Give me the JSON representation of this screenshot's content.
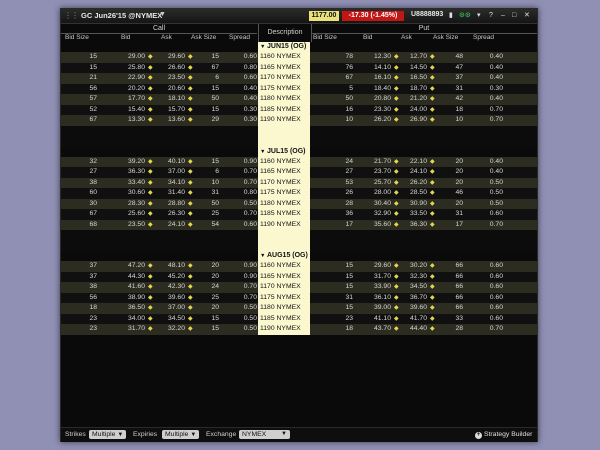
{
  "title_bar": {
    "title": "GC Jun26'15 @NYMEX",
    "price": "1177.00",
    "change": "-17.30 (-1.45%)",
    "account": "U8888893",
    "colors": {
      "price_bg": "#e9e27a",
      "change_bg": "#c41515"
    }
  },
  "headers": {
    "call": "Call",
    "put": "Put",
    "description": "Description",
    "call_columns": [
      "Bid Size",
      "Bid",
      "Ask",
      "Ask Size",
      "Spread"
    ],
    "put_columns": [
      "Bid Size",
      "Bid",
      "Ask",
      "Ask Size",
      "Spread"
    ]
  },
  "groups": [
    {
      "label": "JUN15 (OG)",
      "rows": [
        {
          "c_bsize": "15",
          "c_bid": "29.00",
          "c_ask": "29.60",
          "c_asize": "15",
          "c_spread": "0.60",
          "desc": "1160 NYMEX",
          "p_bsize": "78",
          "p_bid": "12.30",
          "p_ask": "12.70",
          "p_asize": "48",
          "p_spread": "0.40"
        },
        {
          "c_bsize": "15",
          "c_bid": "25.80",
          "c_ask": "26.60",
          "c_asize": "67",
          "c_spread": "0.80",
          "desc": "1165 NYMEX",
          "p_bsize": "76",
          "p_bid": "14.10",
          "p_ask": "14.50",
          "p_asize": "47",
          "p_spread": "0.40"
        },
        {
          "c_bsize": "21",
          "c_bid": "22.90",
          "c_ask": "23.50",
          "c_asize": "6",
          "c_spread": "0.60",
          "desc": "1170 NYMEX",
          "p_bsize": "67",
          "p_bid": "16.10",
          "p_ask": "16.50",
          "p_asize": "37",
          "p_spread": "0.40"
        },
        {
          "c_bsize": "56",
          "c_bid": "20.20",
          "c_ask": "20.60",
          "c_asize": "15",
          "c_spread": "0.40",
          "desc": "1175 NYMEX",
          "p_bsize": "5",
          "p_bid": "18.40",
          "p_ask": "18.70",
          "p_asize": "31",
          "p_spread": "0.30"
        },
        {
          "c_bsize": "57",
          "c_bid": "17.70",
          "c_ask": "18.10",
          "c_asize": "50",
          "c_spread": "0.40",
          "desc": "1180 NYMEX",
          "p_bsize": "50",
          "p_bid": "20.80",
          "p_ask": "21.20",
          "p_asize": "42",
          "p_spread": "0.40"
        },
        {
          "c_bsize": "52",
          "c_bid": "15.40",
          "c_ask": "15.70",
          "c_asize": "15",
          "c_spread": "0.30",
          "desc": "1185 NYMEX",
          "p_bsize": "16",
          "p_bid": "23.30",
          "p_ask": "24.00",
          "p_asize": "18",
          "p_spread": "0.70"
        },
        {
          "c_bsize": "67",
          "c_bid": "13.30",
          "c_ask": "13.60",
          "c_asize": "29",
          "c_spread": "0.30",
          "desc": "1190 NYMEX",
          "p_bsize": "10",
          "p_bid": "26.20",
          "p_ask": "26.90",
          "p_asize": "10",
          "p_spread": "0.70"
        }
      ]
    },
    {
      "label": "JUL15 (OG)",
      "rows": [
        {
          "c_bsize": "32",
          "c_bid": "39.20",
          "c_ask": "40.10",
          "c_asize": "15",
          "c_spread": "0.90",
          "desc": "1160 NYMEX",
          "p_bsize": "24",
          "p_bid": "21.70",
          "p_ask": "22.10",
          "p_asize": "20",
          "p_spread": "0.40"
        },
        {
          "c_bsize": "27",
          "c_bid": "36.30",
          "c_ask": "37.00",
          "c_asize": "6",
          "c_spread": "0.70",
          "desc": "1165 NYMEX",
          "p_bsize": "27",
          "p_bid": "23.70",
          "p_ask": "24.10",
          "p_asize": "20",
          "p_spread": "0.40"
        },
        {
          "c_bsize": "38",
          "c_bid": "33.40",
          "c_ask": "34.10",
          "c_asize": "10",
          "c_spread": "0.70",
          "desc": "1170 NYMEX",
          "p_bsize": "53",
          "p_bid": "25.70",
          "p_ask": "26.20",
          "p_asize": "20",
          "p_spread": "0.50"
        },
        {
          "c_bsize": "60",
          "c_bid": "30.60",
          "c_ask": "31.40",
          "c_asize": "31",
          "c_spread": "0.80",
          "desc": "1175 NYMEX",
          "p_bsize": "26",
          "p_bid": "28.00",
          "p_ask": "28.50",
          "p_asize": "46",
          "p_spread": "0.50"
        },
        {
          "c_bsize": "30",
          "c_bid": "28.30",
          "c_ask": "28.80",
          "c_asize": "50",
          "c_spread": "0.50",
          "desc": "1180 NYMEX",
          "p_bsize": "28",
          "p_bid": "30.40",
          "p_ask": "30.90",
          "p_asize": "20",
          "p_spread": "0.50"
        },
        {
          "c_bsize": "67",
          "c_bid": "25.60",
          "c_ask": "26.30",
          "c_asize": "25",
          "c_spread": "0.70",
          "desc": "1185 NYMEX",
          "p_bsize": "36",
          "p_bid": "32.90",
          "p_ask": "33.50",
          "p_asize": "31",
          "p_spread": "0.60"
        },
        {
          "c_bsize": "68",
          "c_bid": "23.50",
          "c_ask": "24.10",
          "c_asize": "54",
          "c_spread": "0.60",
          "desc": "1190 NYMEX",
          "p_bsize": "17",
          "p_bid": "35.60",
          "p_ask": "36.30",
          "p_asize": "17",
          "p_spread": "0.70"
        }
      ]
    },
    {
      "label": "AUG15 (OG)",
      "rows": [
        {
          "c_bsize": "37",
          "c_bid": "47.20",
          "c_ask": "48.10",
          "c_asize": "20",
          "c_spread": "0.90",
          "desc": "1160 NYMEX",
          "p_bsize": "15",
          "p_bid": "29.60",
          "p_ask": "30.20",
          "p_asize": "66",
          "p_spread": "0.60"
        },
        {
          "c_bsize": "37",
          "c_bid": "44.30",
          "c_ask": "45.20",
          "c_asize": "20",
          "c_spread": "0.90",
          "desc": "1165 NYMEX",
          "p_bsize": "15",
          "p_bid": "31.70",
          "p_ask": "32.30",
          "p_asize": "66",
          "p_spread": "0.60"
        },
        {
          "c_bsize": "38",
          "c_bid": "41.60",
          "c_ask": "42.30",
          "c_asize": "24",
          "c_spread": "0.70",
          "desc": "1170 NYMEX",
          "p_bsize": "15",
          "p_bid": "33.90",
          "p_ask": "34.50",
          "p_asize": "66",
          "p_spread": "0.60"
        },
        {
          "c_bsize": "56",
          "c_bid": "38.90",
          "c_ask": "39.60",
          "c_asize": "25",
          "c_spread": "0.70",
          "desc": "1175 NYMEX",
          "p_bsize": "31",
          "p_bid": "36.10",
          "p_ask": "36.70",
          "p_asize": "66",
          "p_spread": "0.60"
        },
        {
          "c_bsize": "18",
          "c_bid": "36.50",
          "c_ask": "37.00",
          "c_asize": "20",
          "c_spread": "0.50",
          "desc": "1180 NYMEX",
          "p_bsize": "15",
          "p_bid": "39.00",
          "p_ask": "39.60",
          "p_asize": "66",
          "p_spread": "0.60"
        },
        {
          "c_bsize": "23",
          "c_bid": "34.00",
          "c_ask": "34.50",
          "c_asize": "15",
          "c_spread": "0.50",
          "desc": "1185 NYMEX",
          "p_bsize": "23",
          "p_bid": "41.10",
          "p_ask": "41.70",
          "p_asize": "33",
          "p_spread": "0.60"
        },
        {
          "c_bsize": "23",
          "c_bid": "31.70",
          "c_ask": "32.20",
          "c_asize": "15",
          "c_spread": "0.50",
          "desc": "1190 NYMEX",
          "p_bsize": "18",
          "p_bid": "43.70",
          "p_ask": "44.40",
          "p_asize": "28",
          "p_spread": "0.70"
        }
      ]
    }
  ],
  "bottom_bar": {
    "strikes_label": "Strikes",
    "strikes_value": "Multiple",
    "expiries_label": "Expiries",
    "expiries_value": "Multiple",
    "exchange_label": "Exchange",
    "exchange_value": "NYMEX",
    "strategy_builder": "Strategy Builder"
  }
}
